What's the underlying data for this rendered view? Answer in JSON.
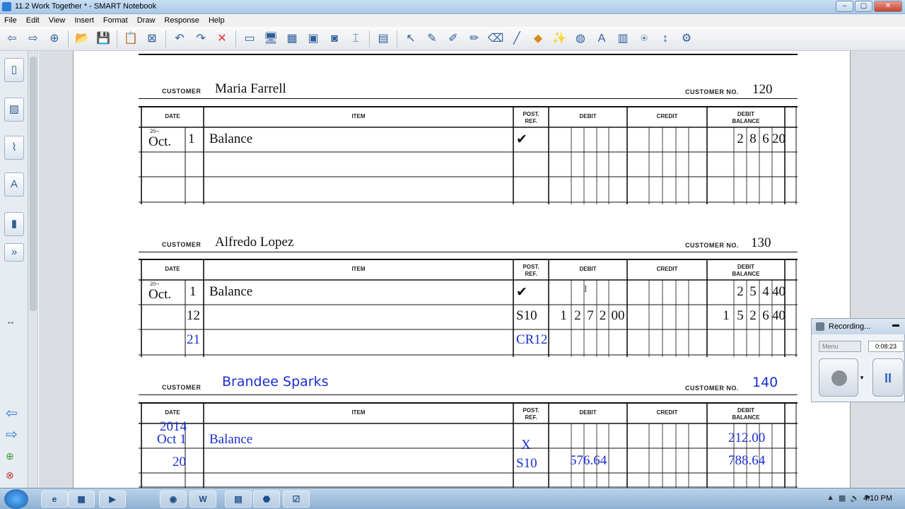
{
  "window": {
    "title": "11.2 Work Together * - SMART Notebook",
    "min": "‒",
    "max": "▢",
    "close": "✕"
  },
  "menu": [
    "File",
    "Edit",
    "View",
    "Insert",
    "Format",
    "Draw",
    "Response",
    "Help"
  ],
  "toolbar": [
    {
      "name": "back-arrow-icon",
      "glyph": "⇦"
    },
    {
      "name": "forward-arrow-icon",
      "glyph": "⇨"
    },
    {
      "name": "add-page-icon",
      "glyph": "⊕"
    },
    {
      "name": "open-folder-icon",
      "glyph": "📂"
    },
    {
      "name": "save-icon",
      "glyph": "💾"
    },
    {
      "name": "paste-icon",
      "glyph": "📋"
    },
    {
      "name": "screen-icon",
      "glyph": "⊠"
    },
    {
      "name": "undo-icon",
      "glyph": "↶"
    },
    {
      "name": "redo-icon",
      "glyph": "↷"
    },
    {
      "name": "delete-icon",
      "glyph": "✕"
    },
    {
      "name": "screen-shade-icon",
      "glyph": "▭"
    },
    {
      "name": "display-icon",
      "glyph": "🖥"
    },
    {
      "name": "capture-icon",
      "glyph": "▦"
    },
    {
      "name": "monitor-icon",
      "glyph": "▣"
    },
    {
      "name": "camera-icon",
      "glyph": "◙"
    },
    {
      "name": "crop-icon",
      "glyph": "⌶"
    },
    {
      "name": "table-icon",
      "glyph": "▤"
    },
    {
      "name": "select-icon",
      "glyph": "↖"
    },
    {
      "name": "pen-icon",
      "glyph": "✎"
    },
    {
      "name": "creative-pen-icon",
      "glyph": "✐"
    },
    {
      "name": "highlighter-icon",
      "glyph": "✏"
    },
    {
      "name": "eraser-icon",
      "glyph": "⌫"
    },
    {
      "name": "line-icon",
      "glyph": "╱"
    },
    {
      "name": "shapes-icon",
      "glyph": "◆"
    },
    {
      "name": "magic-pen-icon",
      "glyph": "✨"
    },
    {
      "name": "fill-icon",
      "glyph": "◍"
    },
    {
      "name": "text-icon",
      "glyph": "A"
    },
    {
      "name": "format-icon",
      "glyph": "▥"
    },
    {
      "name": "compass-icon",
      "glyph": "⍟"
    },
    {
      "name": "resize-icon",
      "glyph": "↕"
    },
    {
      "name": "properties-icon",
      "glyph": "⚙"
    }
  ],
  "labels": {
    "customer": "CUSTOMER",
    "customer_no": "CUSTOMER NO."
  },
  "headers": {
    "date": "DATE",
    "item": "ITEM",
    "post_ref": "POST.\nREF.",
    "debit": "DEBIT",
    "credit": "CREDIT",
    "debit_balance": "DEBIT\nBALANCE"
  },
  "ledger1": {
    "customer": "Maria Farrell",
    "customer_no": "120",
    "year": "20--",
    "month": "Oct.",
    "day": "1",
    "item": "Balance",
    "post": "✔",
    "balance_digits": [
      "2",
      "8",
      "6",
      "20"
    ]
  },
  "ledger2": {
    "customer": "Alfredo Lopez",
    "customer_no": "130",
    "year": "20--",
    "month": "Oct.",
    "rows": [
      {
        "day": "1",
        "item": "Balance",
        "post": "✔",
        "debit": [],
        "balance": [
          "2",
          "5",
          "4",
          "40"
        ]
      },
      {
        "day": "12",
        "item": "",
        "post": "S10",
        "debit": [
          "1",
          "2",
          "7",
          "2",
          "00"
        ],
        "balance": [
          "1",
          "5",
          "2",
          "6",
          "40"
        ]
      },
      {
        "day": "21",
        "item": "",
        "post": "CR12",
        "debit": [],
        "balance": []
      }
    ]
  },
  "ledger3": {
    "customer": "Brandee Sparks",
    "customer_no": "140",
    "year": "2014",
    "rows": [
      {
        "date": "Oct 1",
        "item": "Balance",
        "post": "X",
        "debit": "",
        "balance": "212.00"
      },
      {
        "date": "20",
        "item": "",
        "post": "S10",
        "debit": "576.64",
        "balance": "788.64"
      }
    ]
  },
  "recording": {
    "title": "Recording...",
    "menu": "Menu",
    "time": "0:08:23",
    "pause": "II"
  },
  "taskbar": {
    "clock": "4:10 PM",
    "apps": [
      "e",
      "▦",
      "▶",
      "◉",
      "W",
      "▤",
      "⬣",
      "☑"
    ]
  },
  "colors": {
    "handwriting": "#1a2ed1",
    "titlebar": "#b9d3ee"
  }
}
